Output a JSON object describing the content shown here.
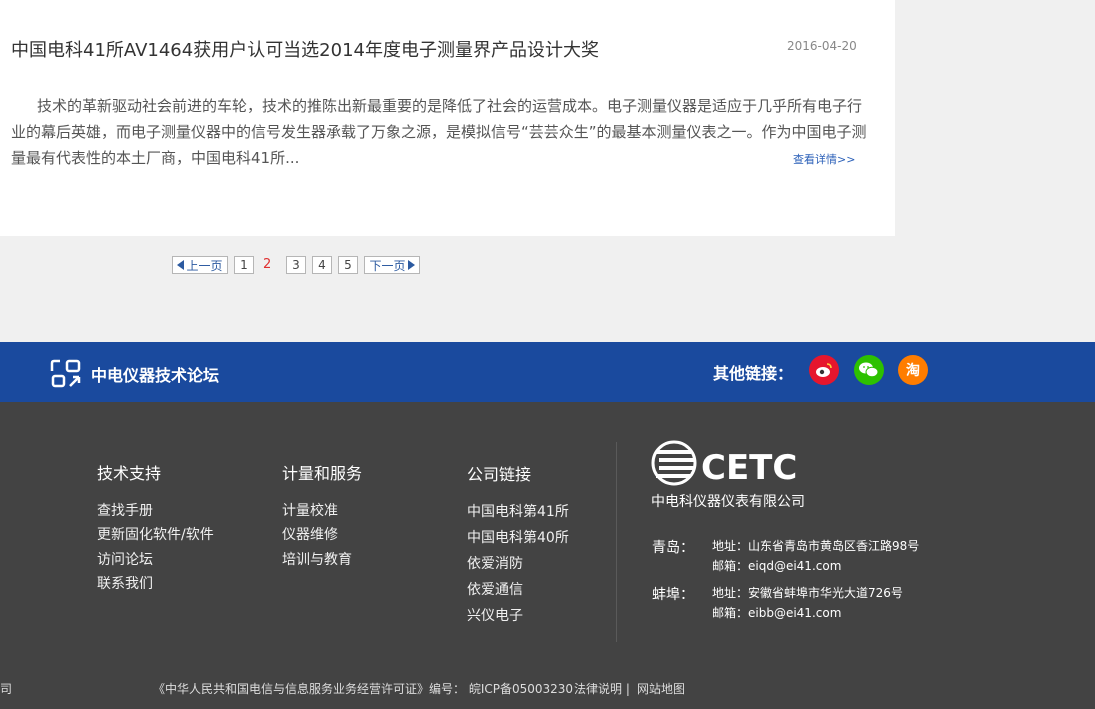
{
  "article": {
    "title": "中国电科41所AV1464获用户认可当选2014年度电子测量界产品设计大奖",
    "date": "2016-04-20",
    "summary": "技术的革新驱动社会前进的车轮，技术的推陈出新最重要的是降低了社会的运营成本。电子测量仪器是适应于几乎所有电子行业的幕后英雄，而电子测量仪器中的信号发生器承载了万象之源，是模拟信号“芸芸众生”的最基本测量仪表之一。作为中国电子测量最有代表性的本土厂商，中国电科41所...",
    "read_more": "查看详情>>"
  },
  "pagination": {
    "prev": "上一页",
    "pages": [
      "1",
      "2",
      "3",
      "4",
      "5"
    ],
    "current": "2",
    "next": "下一页"
  },
  "forum_bar": {
    "title": "中电仪器技术论坛",
    "other_links_label": "其他链接：",
    "icons": [
      "weibo-icon",
      "wechat-icon",
      "taobao-icon"
    ],
    "taobao_glyph": "淘",
    "color": "#1a4a9e"
  },
  "footer": {
    "columns": [
      {
        "heading": "技术支持",
        "items": [
          "查找手册",
          "更新固化软件/软件",
          "访问论坛",
          "联系我们"
        ]
      },
      {
        "heading": "计量和服务",
        "items": [
          "计量校准",
          "仪器维修",
          "培训与教育"
        ]
      },
      {
        "heading": "公司链接",
        "items": [
          "中国电科第41所",
          "中国电科第40所",
          "依爱消防",
          "依爱通信",
          "兴仪电子"
        ]
      }
    ],
    "logo_text": "CETC",
    "company": "中电科仪器仪表有限公司",
    "offices": [
      {
        "city": "青岛：",
        "address": "地址：山东省青岛市黄岛区香江路98号",
        "email": "邮箱：eiqd@ei41.com"
      },
      {
        "city": "蚌埠：",
        "address": "地址：安徽省蚌埠市华光大道726号",
        "email": "邮箱：eibb@ei41.com"
      }
    ],
    "bottom_left_fragment": "司",
    "license": "《中华人民共和国电信与信息服务业务经营许可证》编号： 皖ICP备05003230",
    "legal": "法律说明 |",
    "sitemap": "网站地图",
    "background": "#434343"
  }
}
